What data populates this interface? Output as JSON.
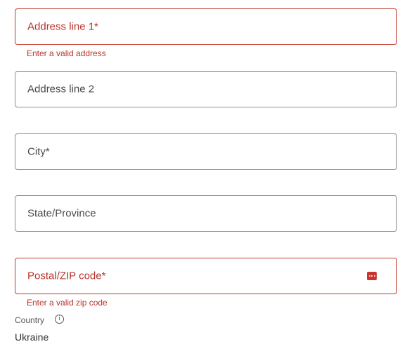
{
  "form": {
    "address_line_1": {
      "label": "Address line 1*",
      "error": "Enter a valid address"
    },
    "address_line_2": {
      "label": "Address line 2"
    },
    "city": {
      "label": "City*"
    },
    "state": {
      "label": "State/Province"
    },
    "postal_code": {
      "label": "Postal/ZIP code*",
      "error": "Enter a valid zip code",
      "icon": "error-more-icon"
    },
    "country": {
      "label": "Country",
      "info_icon_glyph": "i",
      "value": "Ukraine"
    }
  },
  "colors": {
    "error": "#b8342b",
    "border": "#8e8e8e",
    "text": "#4a4a4a"
  }
}
